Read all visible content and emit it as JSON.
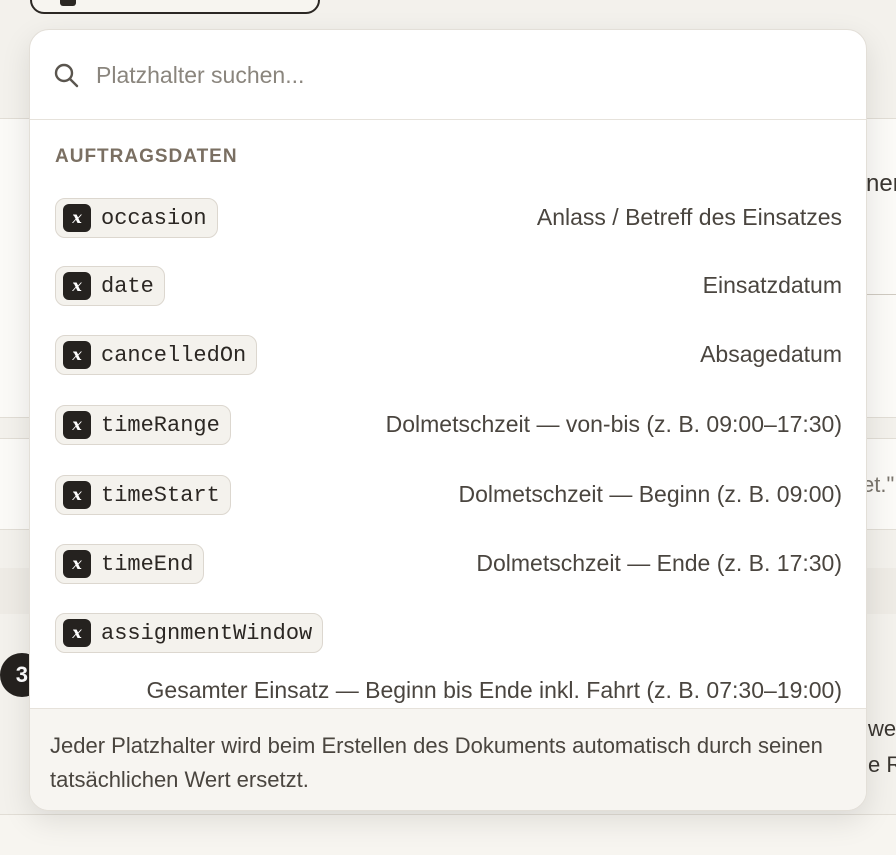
{
  "background": {
    "card1_fragment": "ner",
    "card2_fragment": "et.\"",
    "step_number": "3",
    "lower_fragment_1": "wei",
    "lower_fragment_2": "e R"
  },
  "search": {
    "placeholder": "Platzhalter suchen...",
    "value": "",
    "icon": "search-icon"
  },
  "group": {
    "title": "AUFTRAGSDATEN"
  },
  "token_icon_glyph": "x",
  "items": [
    {
      "name": "occasion",
      "description": "Anlass / Betreff des Einsatzes"
    },
    {
      "name": "date",
      "description": "Einsatzdatum"
    },
    {
      "name": "cancelledOn",
      "description": "Absagedatum"
    },
    {
      "name": "timeRange",
      "description": "Dolmetschzeit — von-bis (z. B. 09:00–17:30)"
    },
    {
      "name": "timeStart",
      "description": "Dolmetschzeit — Beginn (z. B. 09:00)"
    },
    {
      "name": "timeEnd",
      "description": "Dolmetschzeit — Ende (z. B. 17:30)"
    },
    {
      "name": "assignmentWindow",
      "description": "Gesamter Einsatz — Beginn bis Ende inkl. Fahrt (z. B. 07:30–19:00)"
    }
  ],
  "footer": {
    "text": "Jeder Platzhalter wird beim Erstellen des Dokuments automatisch durch seinen tatsächlichen Wert ersetzt."
  },
  "colors": {
    "panel_bg": "#ffffff",
    "page_bg": "#f3f1ec",
    "token_bg": "#f4f2ed",
    "token_icon_bg": "#25221f",
    "group_header": "#7a6f62"
  }
}
